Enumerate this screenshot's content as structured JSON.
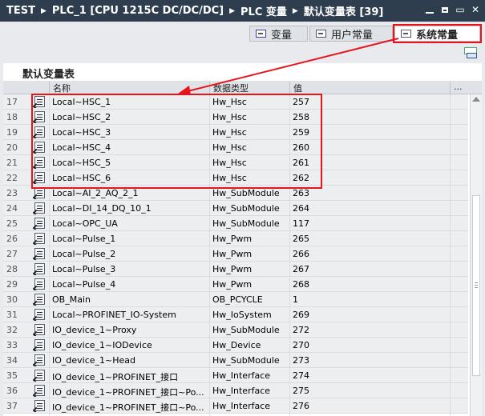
{
  "breadcrumb": [
    "TEST",
    "PLC_1 [CPU 1215C DC/DC/DC]",
    "PLC 变量",
    "默认变量表 [39]"
  ],
  "tabs": [
    {
      "label": "变量",
      "icon": "tag-table-icon"
    },
    {
      "label": "用户常量",
      "icon": "constant-icon"
    },
    {
      "label": "系统常量",
      "icon": "system-constant-icon",
      "active": true
    }
  ],
  "table_title": "默认变量表",
  "columns": {
    "name": "名称",
    "data_type": "数据类型",
    "value": "值",
    "more": "..."
  },
  "rows": [
    {
      "num": "17",
      "name": "Local~HSC_1",
      "type": "Hw_Hsc",
      "value": "257"
    },
    {
      "num": "18",
      "name": "Local~HSC_2",
      "type": "Hw_Hsc",
      "value": "258"
    },
    {
      "num": "19",
      "name": "Local~HSC_3",
      "type": "Hw_Hsc",
      "value": "259"
    },
    {
      "num": "20",
      "name": "Local~HSC_4",
      "type": "Hw_Hsc",
      "value": "260"
    },
    {
      "num": "21",
      "name": "Local~HSC_5",
      "type": "Hw_Hsc",
      "value": "261"
    },
    {
      "num": "22",
      "name": "Local~HSC_6",
      "type": "Hw_Hsc",
      "value": "262"
    },
    {
      "num": "23",
      "name": "Local~AI_2_AQ_2_1",
      "type": "Hw_SubModule",
      "value": "263"
    },
    {
      "num": "24",
      "name": "Local~DI_14_DQ_10_1",
      "type": "Hw_SubModule",
      "value": "264"
    },
    {
      "num": "25",
      "name": "Local~OPC_UA",
      "type": "Hw_SubModule",
      "value": "117"
    },
    {
      "num": "26",
      "name": "Local~Pulse_1",
      "type": "Hw_Pwm",
      "value": "265"
    },
    {
      "num": "27",
      "name": "Local~Pulse_2",
      "type": "Hw_Pwm",
      "value": "266"
    },
    {
      "num": "28",
      "name": "Local~Pulse_3",
      "type": "Hw_Pwm",
      "value": "267"
    },
    {
      "num": "29",
      "name": "Local~Pulse_4",
      "type": "Hw_Pwm",
      "value": "268"
    },
    {
      "num": "30",
      "name": "OB_Main",
      "type": "OB_PCYCLE",
      "value": "1"
    },
    {
      "num": "31",
      "name": "Local~PROFINET_IO-System",
      "type": "Hw_IoSystem",
      "value": "269"
    },
    {
      "num": "32",
      "name": "IO_device_1~Proxy",
      "type": "Hw_SubModule",
      "value": "272"
    },
    {
      "num": "33",
      "name": "IO_device_1~IODevice",
      "type": "Hw_Device",
      "value": "270"
    },
    {
      "num": "34",
      "name": "IO_device_1~Head",
      "type": "Hw_SubModule",
      "value": "273"
    },
    {
      "num": "35",
      "name": "IO_device_1~PROFINET_接口",
      "type": "Hw_Interface",
      "value": "274"
    },
    {
      "num": "36",
      "name": "IO_device_1~PROFINET_接口~Po...",
      "type": "Hw_Interface",
      "value": "275"
    },
    {
      "num": "37",
      "name": "IO_device_1~PROFINET_接口~Po...",
      "type": "Hw_Interface",
      "value": "276"
    }
  ],
  "colors": {
    "titlebar": "#2e3e4e",
    "highlight": "#e8131b"
  }
}
